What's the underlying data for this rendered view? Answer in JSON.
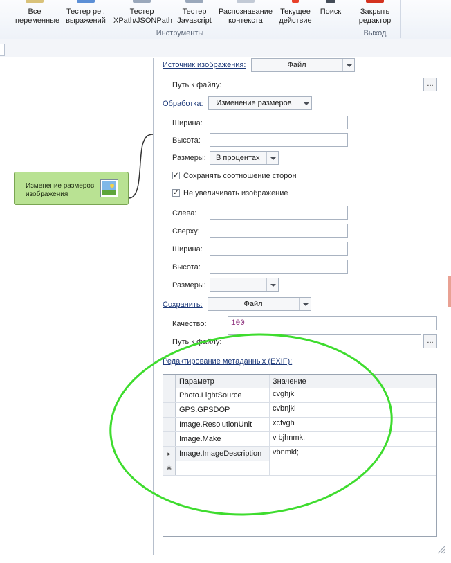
{
  "ribbon": {
    "buttons": [
      {
        "label_line1": "Все",
        "label_line2": "переменные",
        "icon": "variables-icon"
      },
      {
        "label_line1": "Тестер рег.",
        "label_line2": "выражений",
        "icon": "regex-tester-icon"
      },
      {
        "label_line1": "Тестер",
        "label_line2": "XPath/JSONPath",
        "icon": "xpath-tester-icon"
      },
      {
        "label_line1": "Тестер",
        "label_line2": "Javascript",
        "icon": "javascript-tester-icon"
      },
      {
        "label_line1": "Распознавание",
        "label_line2": "контекста",
        "icon": "context-recognition-icon"
      },
      {
        "label_line1": "Текущее",
        "label_line2": "действие",
        "icon": "current-action-icon"
      },
      {
        "label_line1": "Поиск",
        "label_line2": "",
        "icon": "search-icon"
      },
      {
        "label_line1": "Закрыть",
        "label_line2": "редактор",
        "icon": "close-editor-icon"
      }
    ],
    "group_tools": "Инструменты",
    "group_exit": "Выход",
    "accent_color": "#e8402a"
  },
  "canvas": {
    "node": {
      "label": "Изменение размеров изображения",
      "icon": "image-icon",
      "color": "#b9e293"
    }
  },
  "panel": {
    "image_source": {
      "label": "Источник изображения:",
      "value": "Файл"
    },
    "source_path": {
      "label": "Путь к файлу:",
      "value": "",
      "browse": "..."
    },
    "processing": {
      "label": "Обработка:",
      "value": "Изменение размеров"
    },
    "width": {
      "label": "Ширина:",
      "value": ""
    },
    "height": {
      "label": "Высота:",
      "value": ""
    },
    "sizes": {
      "label": "Размеры:",
      "value": "В процентах"
    },
    "keep_aspect": {
      "label": "Сохранять соотношение сторон",
      "checked": true
    },
    "no_enlarge": {
      "label": "Не увеличивать изображение",
      "checked": true
    },
    "left": {
      "label": "Слева:",
      "value": ""
    },
    "top": {
      "label": "Сверху:",
      "value": ""
    },
    "crop_width": {
      "label": "Ширина:",
      "value": ""
    },
    "crop_height": {
      "label": "Высота:",
      "value": ""
    },
    "crop_sizes": {
      "label": "Размеры:",
      "value": ""
    },
    "save": {
      "label": "Сохранить:",
      "value": "Файл"
    },
    "quality": {
      "label": "Качество:",
      "value": "100"
    },
    "save_path": {
      "label": "Путь к файлу:",
      "value": "",
      "browse": "..."
    },
    "exif": {
      "label": "Редактирование метаданных (EXIF):",
      "columns": [
        "Параметр",
        "Значение"
      ],
      "rows": [
        {
          "param": "Photo.LightSource",
          "value": "cvghjk"
        },
        {
          "param": "GPS.GPSDOP",
          "value": "cvbnjkl"
        },
        {
          "param": "Image.ResolutionUnit",
          "value": "xcfvgh"
        },
        {
          "param": "Image.Make",
          "value": "v bjhnmk,"
        },
        {
          "param": "Image.ImageDescription",
          "value": " vbnmkl;"
        }
      ],
      "current_row_marker": "▸",
      "new_row_marker": "✱"
    },
    "highlight_color": "#3edc2e"
  }
}
